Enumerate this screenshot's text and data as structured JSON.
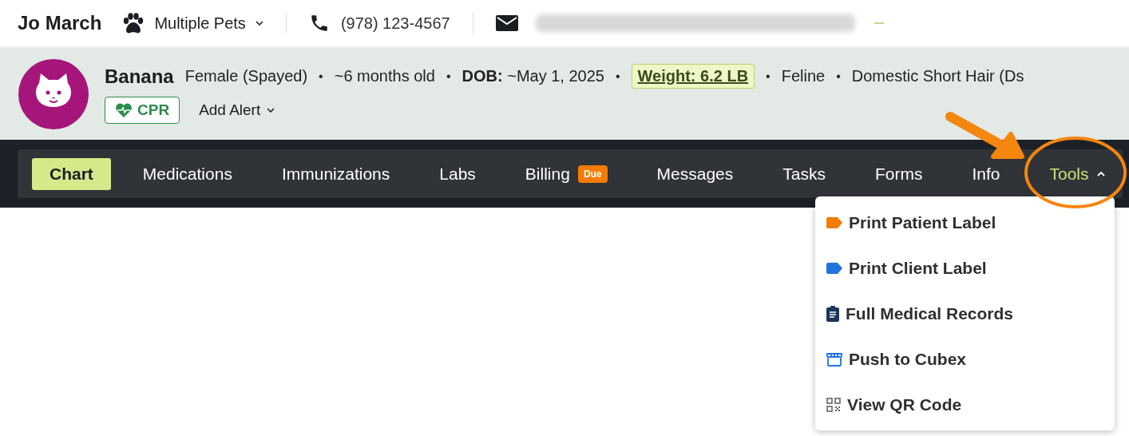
{
  "client": {
    "name": "Jo March",
    "pets_label": "Multiple Pets",
    "phone": "(978) 123-4567"
  },
  "patient": {
    "name": "Banana",
    "separator": "•",
    "details": [
      {
        "kind": "text",
        "text": "Female (Spayed)"
      },
      {
        "kind": "text",
        "text": "~6 months old"
      },
      {
        "kind": "labeled",
        "label": "DOB:",
        "text": "~May 1, 2025"
      },
      {
        "kind": "weight",
        "text": "Weight: 6.2 LB"
      },
      {
        "kind": "text",
        "text": "Feline"
      },
      {
        "kind": "text",
        "text": "Domestic Short Hair (Ds"
      }
    ],
    "cpr_label": "CPR",
    "alert_label": "Add Alert"
  },
  "tabs": [
    {
      "label": "Chart",
      "selected": true,
      "kind": "tab"
    },
    {
      "label": "Medications",
      "selected": false,
      "kind": "tab"
    },
    {
      "label": "Immunizations",
      "selected": false,
      "kind": "tab"
    },
    {
      "label": "Labs",
      "selected": false,
      "kind": "tab"
    },
    {
      "label": "Billing",
      "selected": false,
      "kind": "tab",
      "badge": "Due"
    },
    {
      "label": "Messages",
      "selected": false,
      "kind": "tab"
    },
    {
      "label": "Tasks",
      "selected": false,
      "kind": "tab"
    },
    {
      "label": "Forms",
      "selected": false,
      "kind": "tab"
    },
    {
      "label": "Info",
      "selected": false,
      "kind": "tab"
    },
    {
      "label": "Tools",
      "selected": false,
      "kind": "dropdown",
      "expanded": true
    }
  ],
  "tools_menu": [
    {
      "label": "Print Patient Label",
      "kind": "tag",
      "color": "#f57c00"
    },
    {
      "label": "Print Client Label",
      "kind": "tag",
      "color": "#1f74e0"
    },
    {
      "label": "Full Medical Records",
      "kind": "clipboard"
    },
    {
      "label": "Push to Cubex",
      "kind": "store"
    },
    {
      "label": "View QR Code",
      "kind": "qr"
    }
  ]
}
